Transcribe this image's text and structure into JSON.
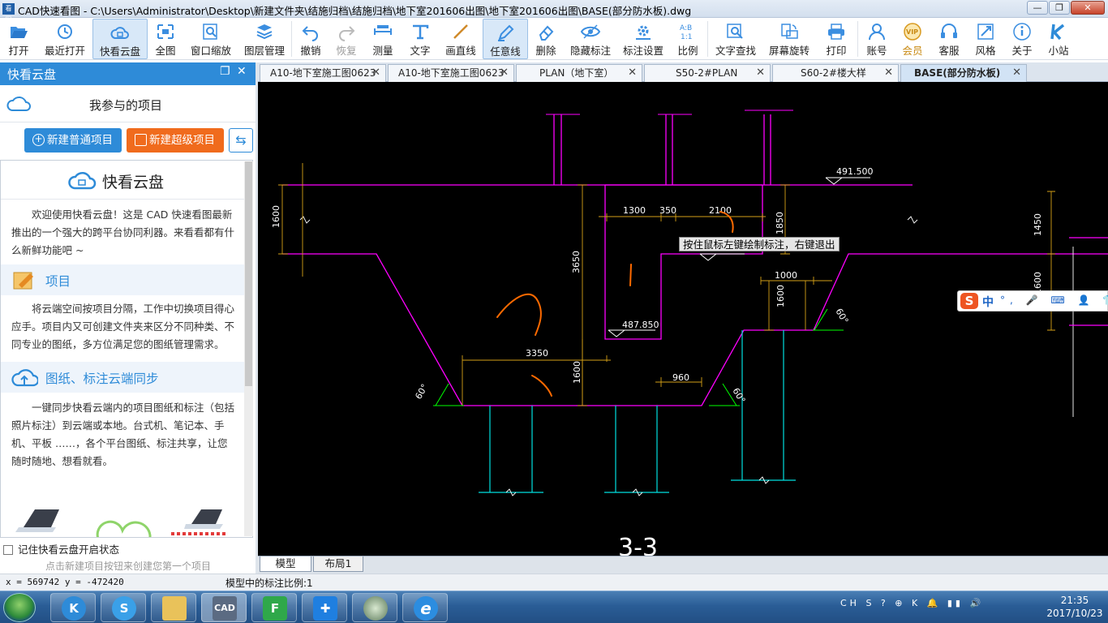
{
  "window": {
    "title": "CAD快速看图 - C:\\Users\\Administrator\\Desktop\\新建文件夹\\结施归档\\结施归档\\地下室201606出图\\地下室201606出图\\BASE(部分防水板).dwg",
    "app_icon": "看图"
  },
  "toolbar": {
    "items": [
      {
        "label": "打开",
        "icon": "folder-open-icon"
      },
      {
        "label": "最近打开",
        "icon": "recent-clock-icon"
      },
      {
        "label": "快看云盘",
        "icon": "cloud-icon"
      },
      {
        "label": "全图",
        "icon": "fullscreen-icon"
      },
      {
        "label": "窗口缩放",
        "icon": "window-zoom-icon"
      },
      {
        "label": "图层管理",
        "icon": "layers-icon"
      },
      {
        "label": "撤销",
        "icon": "undo-icon"
      },
      {
        "label": "恢复",
        "icon": "redo-icon"
      },
      {
        "label": "测量",
        "icon": "measure-icon"
      },
      {
        "label": "文字",
        "icon": "text-icon"
      },
      {
        "label": "画直线",
        "icon": "line-icon"
      },
      {
        "label": "任意线",
        "icon": "pen-icon"
      },
      {
        "label": "删除",
        "icon": "eraser-icon"
      },
      {
        "label": "隐藏标注",
        "icon": "eye-icon"
      },
      {
        "label": "标注设置",
        "icon": "annotation-settings-icon"
      },
      {
        "label": "比例",
        "icon": "scale-icon",
        "glyph": "A:B\n1:1"
      },
      {
        "label": "文字查找",
        "icon": "text-search-icon"
      },
      {
        "label": "屏幕旋转",
        "icon": "rotate-screen-icon"
      },
      {
        "label": "打印",
        "icon": "printer-icon"
      },
      {
        "label": "账号",
        "icon": "user-icon"
      },
      {
        "label": "会员",
        "icon": "vip-icon",
        "glyph": "VIP"
      },
      {
        "label": "客服",
        "icon": "headset-icon"
      },
      {
        "label": "风格",
        "icon": "style-icon"
      },
      {
        "label": "关于",
        "icon": "info-icon"
      },
      {
        "label": "小站",
        "icon": "k-logo-icon"
      }
    ]
  },
  "panel": {
    "title": "快看云盘",
    "project_title": "我参与的项目",
    "btn_new_normal": "新建普通项目",
    "btn_new_super": "新建超级项目",
    "welcome_title": "快看云盘",
    "intro": "欢迎使用快看云盘！这是 CAD 快速看图最新推出的一个强大的跨平台协同利器。来看看都有什么新鲜功能吧 ~",
    "section1_title": "项目",
    "section1_text": "将云端空间按项目分隔，工作中切换项目得心应手。项目内又可创建文件夹来区分不同种类、不同专业的图纸，多方位满足您的图纸管理需求。",
    "section2_title": "图纸、标注云端同步",
    "section2_text": "一键同步快看云端内的项目图纸和标注（包括照片标注）到云端或本地。台式机、笔记本、手机、平板 ……，各个平台图纸、标注共享，让您随时随地、想看就看。",
    "remember": "记住快看云盘开启状态",
    "hint": "点击新建项目按钮来创建您第一个项目"
  },
  "tabs": [
    {
      "label": "A10-地下室施工图0623"
    },
    {
      "label": "A10-地下室施工图0623"
    },
    {
      "label": "PLAN（地下室）"
    },
    {
      "label": "S50-2#PLAN"
    },
    {
      "label": "S60-2#楼大样"
    },
    {
      "label": "BASE(部分防水板)"
    }
  ],
  "canvas": {
    "tooltip": "按住鼠标左键绘制标注，右键退出",
    "dims": {
      "d491": "491.500",
      "d1300": "1300",
      "d350": "350",
      "d2100": "2100",
      "d1600a": "1600",
      "d1850": "1850",
      "d3650": "3650",
      "d487850": "487.850",
      "d3350": "3350",
      "d1600b": "1600",
      "d960": "960",
      "d1000": "1000",
      "d1600c": "1600",
      "d1450": "1450",
      "d1600d": "1600",
      "a60_1": "60°",
      "a60_2": "60°",
      "a60_3": "60°",
      "pt": "487.850",
      "section": "3-3"
    }
  },
  "ime": {
    "logo": "S",
    "lang": "中",
    "extras": "°, 🎤 ⌨ 👤 👕 🔧"
  },
  "layout_tabs": {
    "model": "模型",
    "layout1": "布局1"
  },
  "status": {
    "coords": "x = 569742  y = -472420",
    "scale": "模型中的标注比例:1"
  },
  "taskbar": {
    "tray": "CH S ? ⊕ K 🔔 ▮▮ 🔊",
    "time": "21:35",
    "date": "2017/10/23"
  }
}
